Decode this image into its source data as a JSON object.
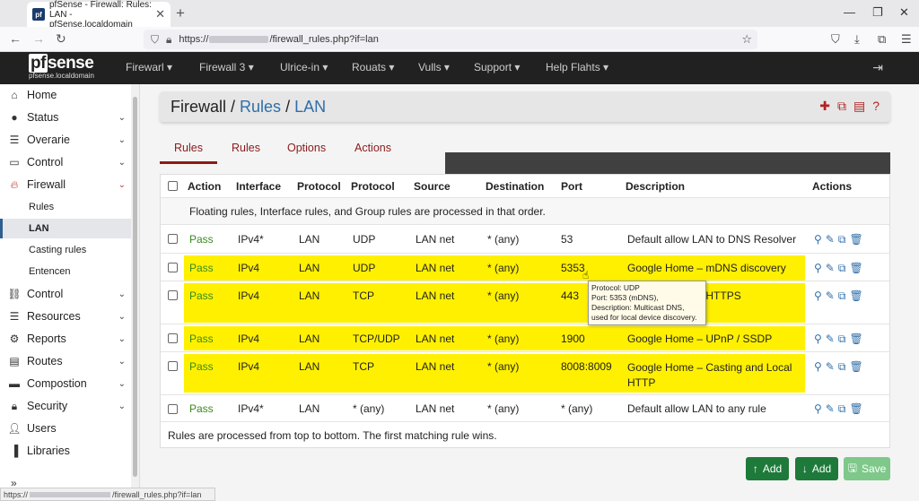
{
  "browser": {
    "tab_title": "pfSense - Firewall: Rules: LAN - pfSense.localdomain",
    "url_prefix": "https://",
    "url_suffix": "/firewall_rules.php?if=lan",
    "status_prefix": "https://",
    "status_suffix": "/firewall_rules.php?if=lan"
  },
  "header": {
    "logo_main": "sense",
    "logo_pf": "pf",
    "logo_sub": "pfsense.localdomain",
    "menu": [
      "Firewarl",
      "Firewall 3",
      "Ulrice-in",
      "Rouats",
      "Vulls",
      "Support",
      "Help Flahts"
    ]
  },
  "sidebar": {
    "items": [
      {
        "label": "Home",
        "icon": "home-icon"
      },
      {
        "label": "Status",
        "icon": "info-icon"
      },
      {
        "label": "Overarie",
        "icon": "list-icon"
      },
      {
        "label": "Control",
        "icon": "monitor-icon"
      },
      {
        "label": "Firewall",
        "icon": "fire-icon"
      },
      {
        "label": "Control",
        "icon": "network-icon"
      },
      {
        "label": "Resources",
        "icon": "list-icon"
      },
      {
        "label": "Reports",
        "icon": "gear-icon"
      },
      {
        "label": "Routes",
        "icon": "document-icon"
      },
      {
        "label": "Compostion",
        "icon": "folder-icon"
      },
      {
        "label": "Security",
        "icon": "lock-icon"
      },
      {
        "label": "Users",
        "icon": "user-icon"
      },
      {
        "label": "Libraries",
        "icon": "book-icon"
      }
    ],
    "subitems": [
      "Rules",
      "LAN",
      "Casting rules",
      "Entencen"
    ]
  },
  "page": {
    "crumb1": "Firewall",
    "sep": "/",
    "crumb2": "Rules",
    "crumb3": "LAN"
  },
  "tabs": [
    "Rules",
    "Rules",
    "Options",
    "Actions"
  ],
  "table": {
    "headers": [
      "Action",
      "Interface",
      "Protocol",
      "Protocol",
      "Source",
      "Destination",
      "Port",
      "Description",
      "Actions"
    ],
    "note": "Floating rules, Interface rules, and Group rules are processed in that order.",
    "rows": [
      {
        "action": "Pass",
        "iface": "IPv4*",
        "proto1": "LAN",
        "proto2": "UDP",
        "source": "LAN net",
        "dest": "* (any)",
        "port": "53",
        "desc": "Default allow LAN to DNS Resolver"
      },
      {
        "action": "Pass",
        "iface": "IPv4",
        "proto1": "LAN",
        "proto2": "UDP",
        "source": "LAN net",
        "dest": "* (any)",
        "port": "5353",
        "desc": "Google Home – mDNS discovery"
      },
      {
        "action": "Pass",
        "iface": "IPv4",
        "proto1": "LAN",
        "proto2": "TCP",
        "source": "LAN net",
        "dest": "* (any)",
        "port": "443",
        "desc": "Google Home – HTTPS"
      },
      {
        "action": "Pass",
        "iface": "IPv4",
        "proto1": "LAN",
        "proto2": "TCP/UDP",
        "source": "LAN net",
        "dest": "* (any)",
        "port": "1900",
        "desc": "Google Home – UPnP / SSDP"
      },
      {
        "action": "Pass",
        "iface": "IPv4",
        "proto1": "LAN",
        "proto2": "TCP",
        "source": "LAN net",
        "dest": "* (any)",
        "port": "8008:8009",
        "desc": "Google Home – Casting and Local HTTP"
      },
      {
        "action": "Pass",
        "iface": "IPv4*",
        "proto1": "LAN",
        "proto2": "* (any)",
        "source": "LAN net",
        "dest": "* (any)",
        "port": "* (any)",
        "desc": "Default allow LAN to any rule"
      }
    ],
    "footer": "Rules are processed from top to bottom. The first matching rule wins."
  },
  "tooltip": {
    "l1": "Protocol: UDP",
    "l2": "Port: 5353 (mDNS),",
    "l3": "Description: Multicast DNS,",
    "l4": "used for local device discovery."
  },
  "buttons": {
    "add1": "Add",
    "add2": "Add",
    "save": "Save"
  },
  "colors": {
    "highlight": "#fff000",
    "pass": "#3a8a1e",
    "accent": "#8b1a1a",
    "link": "#2f6fa8"
  }
}
